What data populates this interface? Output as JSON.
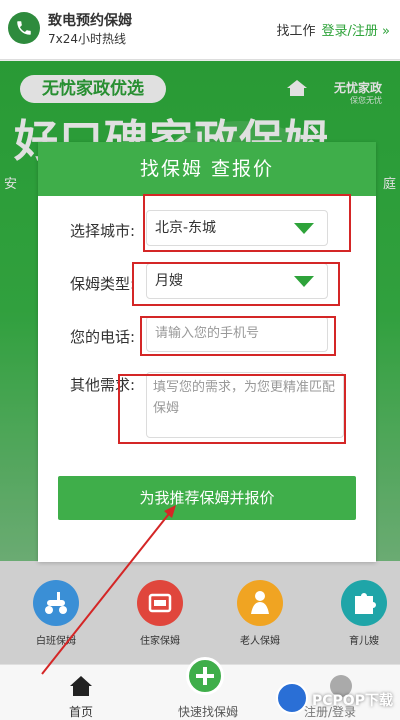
{
  "header": {
    "title": "致电预约保姆",
    "subtitle": "7x24小时热线",
    "find_job": "找工作",
    "login": "登录/注册 »"
  },
  "hero": {
    "badge": "无忧家政优选",
    "logo_name": "无忧家政",
    "logo_tagline": "保您无忧",
    "big_text": "好口碑家政保姆",
    "left_fragment": "安",
    "right_fragment": "庭"
  },
  "modal": {
    "title": "找保姆  查报价",
    "city_label": "选择城市:",
    "city_value": "北京-东城",
    "type_label": "保姆类型:",
    "type_value": "月嫂",
    "phone_label": "您的电话:",
    "phone_placeholder": "请输入您的手机号",
    "other_label": "其他需求:",
    "other_placeholder": "填写您的需求，为您更精准匹配保姆",
    "submit": "为我推荐保姆并报价"
  },
  "services": [
    {
      "label": "白班保姆",
      "icon": "scooter-icon",
      "color": "#3a8fd6"
    },
    {
      "label": "住家保姆",
      "icon": "bed-icon",
      "color": "#e0463c"
    },
    {
      "label": "老人保姆",
      "icon": "elder-icon",
      "color": "#f0a422"
    },
    {
      "label": "育儿嫂",
      "icon": "puzzle-icon",
      "color": "#1fa5a8"
    }
  ],
  "bottom_nav": {
    "home": "首页",
    "quick": "快速找保姆",
    "login": "注册/登录"
  },
  "watermark": "PCPOP下载",
  "colors": {
    "primary_green": "#3fae4a",
    "annotation_red": "#d42626"
  }
}
